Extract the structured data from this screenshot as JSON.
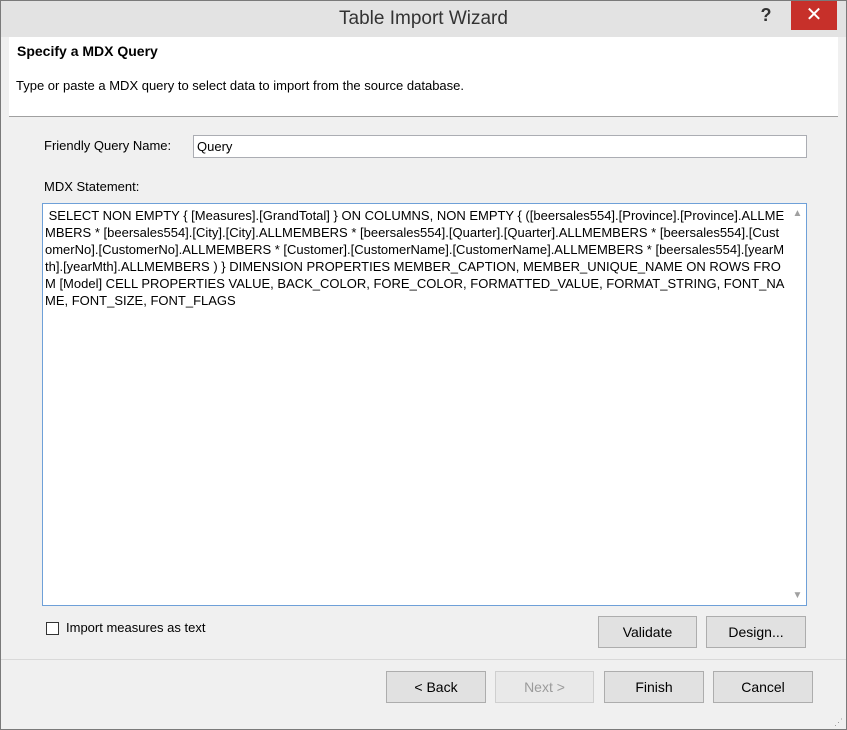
{
  "window": {
    "title": "Table Import Wizard",
    "help_glyph": "?",
    "close_glyph": "✕"
  },
  "header": {
    "title": "Specify a MDX Query",
    "description": "Type or paste a MDX query to select data to import from the source database."
  },
  "form": {
    "friendly_name_label": "Friendly Query Name:",
    "friendly_name_value": "Query",
    "mdx_label": "MDX Statement:",
    "mdx_statement": " SELECT NON EMPTY { [Measures].[GrandTotal] } ON COLUMNS, NON EMPTY { ([beersales554].[Province].[Province].ALLMEMBERS * [beersales554].[City].[City].ALLMEMBERS * [beersales554].[Quarter].[Quarter].ALLMEMBERS * [beersales554].[CustomerNo].[CustomerNo].ALLMEMBERS * [Customer].[CustomerName].[CustomerName].ALLMEMBERS * [beersales554].[yearMth].[yearMth].ALLMEMBERS ) } DIMENSION PROPERTIES MEMBER_CAPTION, MEMBER_UNIQUE_NAME ON ROWS FROM [Model] CELL PROPERTIES VALUE, BACK_COLOR, FORE_COLOR, FORMATTED_VALUE, FORMAT_STRING, FONT_NAME, FONT_SIZE, FONT_FLAGS",
    "import_measures_label": "Import measures as text",
    "import_measures_checked": false,
    "validate_label": "Validate",
    "design_label": "Design..."
  },
  "footer": {
    "back_label": "< Back",
    "next_label": "Next >",
    "finish_label": "Finish",
    "cancel_label": "Cancel"
  },
  "colors": {
    "close_button": "#c7302a",
    "focus_border": "#6ea0d8"
  }
}
